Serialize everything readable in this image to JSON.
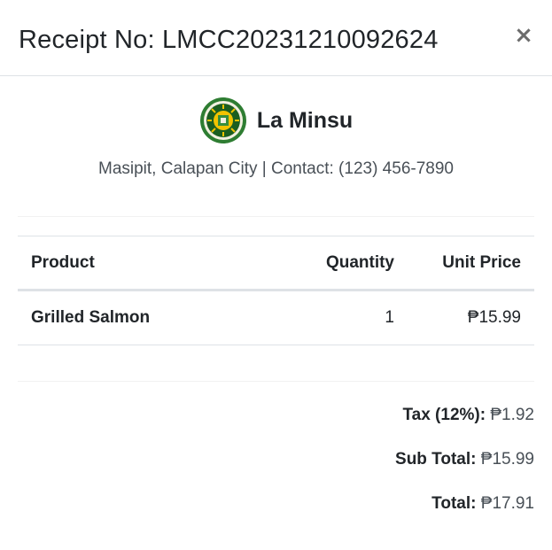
{
  "modal": {
    "title": "Receipt No: LMCC20231210092624",
    "close_label": "×"
  },
  "store": {
    "name": "La Minsu",
    "address_line": "Masipit, Calapan City | Contact: (123) 456-7890"
  },
  "table": {
    "headers": {
      "product": "Product",
      "quantity": "Quantity",
      "unit_price": "Unit Price"
    },
    "rows": [
      {
        "product": "Grilled Salmon",
        "quantity": "1",
        "unit_price": "₱15.99"
      }
    ]
  },
  "totals": {
    "tax_label": "Tax (12%):",
    "tax_value": "₱1.92",
    "subtotal_label": "Sub Total:",
    "subtotal_value": "₱15.99",
    "total_label": "Total:",
    "total_value": "₱17.91"
  },
  "colors": {
    "logo_ring": "#2e7d32",
    "logo_gold": "#f2c300",
    "border": "#dee2e6"
  }
}
